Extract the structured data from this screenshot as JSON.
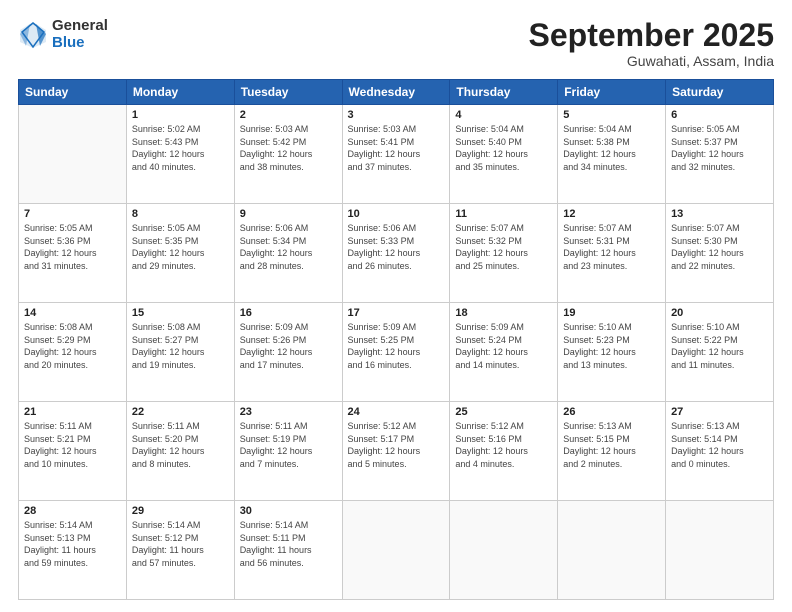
{
  "logo": {
    "general": "General",
    "blue": "Blue"
  },
  "header": {
    "month": "September 2025",
    "location": "Guwahati, Assam, India"
  },
  "days_of_week": [
    "Sunday",
    "Monday",
    "Tuesday",
    "Wednesday",
    "Thursday",
    "Friday",
    "Saturday"
  ],
  "weeks": [
    [
      {
        "day": "",
        "info": ""
      },
      {
        "day": "1",
        "info": "Sunrise: 5:02 AM\nSunset: 5:43 PM\nDaylight: 12 hours\nand 40 minutes."
      },
      {
        "day": "2",
        "info": "Sunrise: 5:03 AM\nSunset: 5:42 PM\nDaylight: 12 hours\nand 38 minutes."
      },
      {
        "day": "3",
        "info": "Sunrise: 5:03 AM\nSunset: 5:41 PM\nDaylight: 12 hours\nand 37 minutes."
      },
      {
        "day": "4",
        "info": "Sunrise: 5:04 AM\nSunset: 5:40 PM\nDaylight: 12 hours\nand 35 minutes."
      },
      {
        "day": "5",
        "info": "Sunrise: 5:04 AM\nSunset: 5:38 PM\nDaylight: 12 hours\nand 34 minutes."
      },
      {
        "day": "6",
        "info": "Sunrise: 5:05 AM\nSunset: 5:37 PM\nDaylight: 12 hours\nand 32 minutes."
      }
    ],
    [
      {
        "day": "7",
        "info": "Sunrise: 5:05 AM\nSunset: 5:36 PM\nDaylight: 12 hours\nand 31 minutes."
      },
      {
        "day": "8",
        "info": "Sunrise: 5:05 AM\nSunset: 5:35 PM\nDaylight: 12 hours\nand 29 minutes."
      },
      {
        "day": "9",
        "info": "Sunrise: 5:06 AM\nSunset: 5:34 PM\nDaylight: 12 hours\nand 28 minutes."
      },
      {
        "day": "10",
        "info": "Sunrise: 5:06 AM\nSunset: 5:33 PM\nDaylight: 12 hours\nand 26 minutes."
      },
      {
        "day": "11",
        "info": "Sunrise: 5:07 AM\nSunset: 5:32 PM\nDaylight: 12 hours\nand 25 minutes."
      },
      {
        "day": "12",
        "info": "Sunrise: 5:07 AM\nSunset: 5:31 PM\nDaylight: 12 hours\nand 23 minutes."
      },
      {
        "day": "13",
        "info": "Sunrise: 5:07 AM\nSunset: 5:30 PM\nDaylight: 12 hours\nand 22 minutes."
      }
    ],
    [
      {
        "day": "14",
        "info": "Sunrise: 5:08 AM\nSunset: 5:29 PM\nDaylight: 12 hours\nand 20 minutes."
      },
      {
        "day": "15",
        "info": "Sunrise: 5:08 AM\nSunset: 5:27 PM\nDaylight: 12 hours\nand 19 minutes."
      },
      {
        "day": "16",
        "info": "Sunrise: 5:09 AM\nSunset: 5:26 PM\nDaylight: 12 hours\nand 17 minutes."
      },
      {
        "day": "17",
        "info": "Sunrise: 5:09 AM\nSunset: 5:25 PM\nDaylight: 12 hours\nand 16 minutes."
      },
      {
        "day": "18",
        "info": "Sunrise: 5:09 AM\nSunset: 5:24 PM\nDaylight: 12 hours\nand 14 minutes."
      },
      {
        "day": "19",
        "info": "Sunrise: 5:10 AM\nSunset: 5:23 PM\nDaylight: 12 hours\nand 13 minutes."
      },
      {
        "day": "20",
        "info": "Sunrise: 5:10 AM\nSunset: 5:22 PM\nDaylight: 12 hours\nand 11 minutes."
      }
    ],
    [
      {
        "day": "21",
        "info": "Sunrise: 5:11 AM\nSunset: 5:21 PM\nDaylight: 12 hours\nand 10 minutes."
      },
      {
        "day": "22",
        "info": "Sunrise: 5:11 AM\nSunset: 5:20 PM\nDaylight: 12 hours\nand 8 minutes."
      },
      {
        "day": "23",
        "info": "Sunrise: 5:11 AM\nSunset: 5:19 PM\nDaylight: 12 hours\nand 7 minutes."
      },
      {
        "day": "24",
        "info": "Sunrise: 5:12 AM\nSunset: 5:17 PM\nDaylight: 12 hours\nand 5 minutes."
      },
      {
        "day": "25",
        "info": "Sunrise: 5:12 AM\nSunset: 5:16 PM\nDaylight: 12 hours\nand 4 minutes."
      },
      {
        "day": "26",
        "info": "Sunrise: 5:13 AM\nSunset: 5:15 PM\nDaylight: 12 hours\nand 2 minutes."
      },
      {
        "day": "27",
        "info": "Sunrise: 5:13 AM\nSunset: 5:14 PM\nDaylight: 12 hours\nand 0 minutes."
      }
    ],
    [
      {
        "day": "28",
        "info": "Sunrise: 5:14 AM\nSunset: 5:13 PM\nDaylight: 11 hours\nand 59 minutes."
      },
      {
        "day": "29",
        "info": "Sunrise: 5:14 AM\nSunset: 5:12 PM\nDaylight: 11 hours\nand 57 minutes."
      },
      {
        "day": "30",
        "info": "Sunrise: 5:14 AM\nSunset: 5:11 PM\nDaylight: 11 hours\nand 56 minutes."
      },
      {
        "day": "",
        "info": ""
      },
      {
        "day": "",
        "info": ""
      },
      {
        "day": "",
        "info": ""
      },
      {
        "day": "",
        "info": ""
      }
    ]
  ]
}
